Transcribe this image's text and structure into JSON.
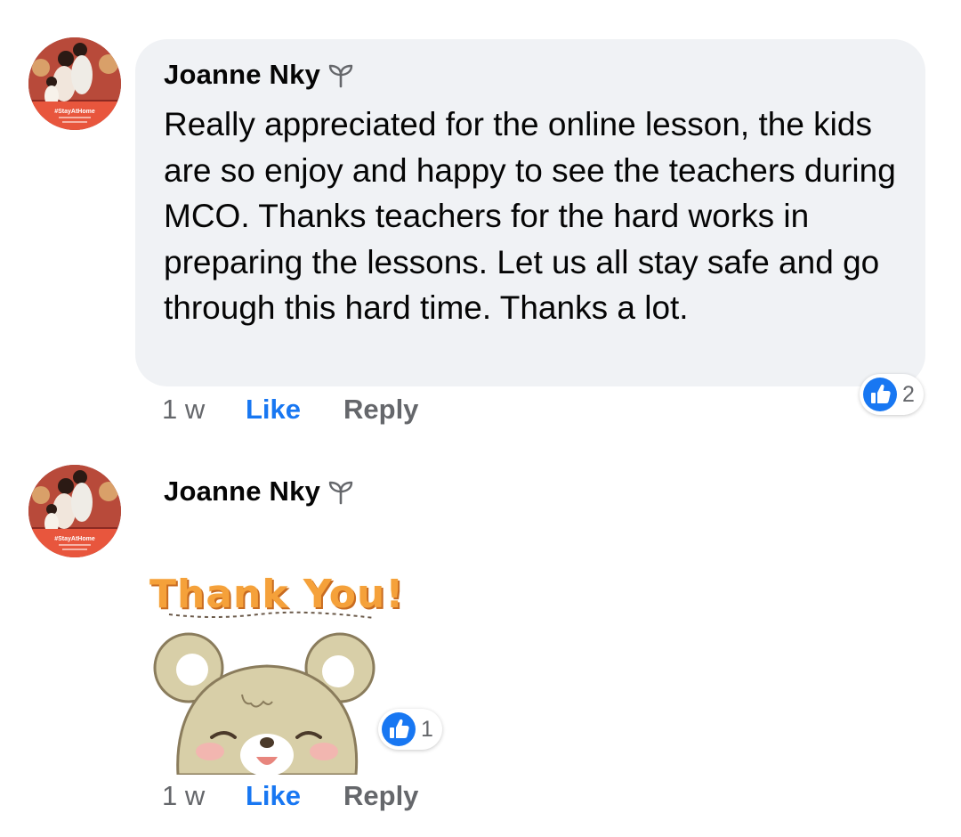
{
  "comments": [
    {
      "author": "Joanne Nky",
      "badge_icon": "sprout-icon",
      "text": "Really appreciated for the online lesson, the kids are so enjoy and happy to see the teachers during MCO. Thanks teachers for the hard works in preparing the lessons. Let us all stay safe and go through this hard time. Thanks a lot.",
      "time": "1 w",
      "like_label": "Like",
      "reply_label": "Reply",
      "reaction_count": "2",
      "reaction_icon": "thumbs-up-icon"
    },
    {
      "author": "Joanne Nky",
      "badge_icon": "sprout-icon",
      "sticker_text": "Thank You!",
      "sticker_icon": "bear-sticker-icon",
      "time": "1 w",
      "like_label": "Like",
      "reply_label": "Reply",
      "reaction_count": "1",
      "reaction_icon": "thumbs-up-icon"
    }
  ],
  "avatar_overlay_text": "#StayAtHome",
  "colors": {
    "link_blue": "#1877f2",
    "bubble_bg": "#f0f2f5",
    "meta_gray": "#65676b",
    "avatar_frame": "#e8563d"
  }
}
